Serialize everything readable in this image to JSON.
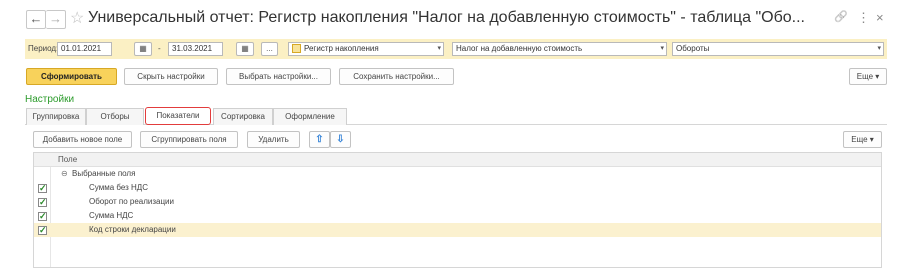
{
  "titlebar": {
    "back_icon": "←",
    "forward_icon": "→",
    "star_icon": "☆",
    "title": "Универсальный отчет: Регистр накопления \"Налог на добавленную стоимость\" - таблица \"Обо...",
    "link_icon": "🔗",
    "more_icon": "⋮",
    "close_icon": "×"
  },
  "period": {
    "label": "Период:",
    "from": "01.01.2021",
    "dash": "-",
    "to": "31.03.2021",
    "calendar_icon": "▦",
    "ellipsis_label": "...",
    "source_type": "Регистр накопления",
    "source_name": "Налог на добавленную стоимость",
    "table": "Обороты",
    "dropdown_icon": "▾"
  },
  "toolbar": {
    "generate": "Сформировать",
    "hide_settings": "Скрыть настройки",
    "choose_settings": "Выбрать настройки...",
    "save_settings": "Сохранить настройки...",
    "more": "Еще ▾"
  },
  "settings": {
    "title": "Настройки",
    "tabs": [
      "Группировка",
      "Отборы",
      "Показатели",
      "Сортировка",
      "Оформление"
    ]
  },
  "panel": {
    "add_field": "Добавить новое поле",
    "group_fields": "Сгруппировать поля",
    "delete": "Удалить",
    "up_icon": "⇧",
    "down_icon": "⇩",
    "more": "Еще ▾",
    "column_header": "Поле",
    "group_row": "Выбранные поля",
    "collapse_icon": "⊖",
    "fields": [
      {
        "label": "Сумма без НДС",
        "checked": true
      },
      {
        "label": "Оборот по реализации",
        "checked": true
      },
      {
        "label": "Сумма НДС",
        "checked": true
      },
      {
        "label": "Код строки декларации",
        "checked": true
      }
    ]
  },
  "colors": {
    "accent_yellow": "#f8d25b",
    "band_yellow": "#fbf0c4",
    "settings_green": "#2b9b2b",
    "active_tab_border": "#e23c3c"
  }
}
